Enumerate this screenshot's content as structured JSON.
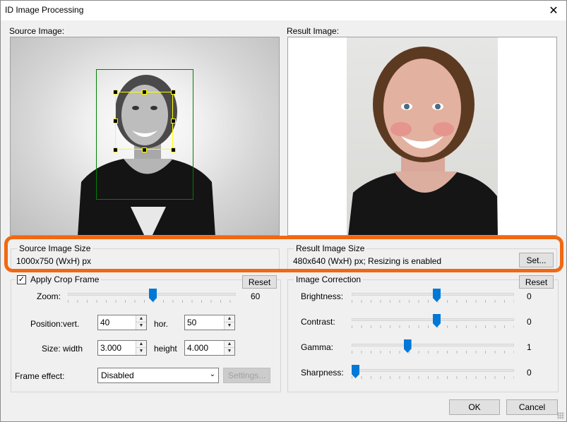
{
  "window": {
    "title": "ID Image Processing"
  },
  "source": {
    "label": "Source Image:"
  },
  "result": {
    "label": "Result Image:"
  },
  "source_size": {
    "title": "Source Image Size",
    "value": "1000x750 (WxH) px"
  },
  "result_size": {
    "title": "Result Image Size",
    "value": "480x640 (WxH) px; Resizing is enabled",
    "set_label": "Set..."
  },
  "crop": {
    "checkbox_label": "Apply Crop Frame",
    "checked": true,
    "reset_label": "Reset",
    "zoom_label": "Zoom:",
    "zoom_value": "60",
    "zoom_level": 0.6,
    "position_label": "Position:",
    "vert_label": "vert.",
    "vert_value": "40",
    "hor_label": "hor.",
    "hor_value": "50",
    "size_label": "Size:",
    "width_label": "width",
    "width_value": "3.000",
    "height_label": "height",
    "height_value": "4.000",
    "frame_effect_label": "Frame effect:",
    "frame_effect_value": "Disabled",
    "settings_label": "Settings..."
  },
  "correction": {
    "title": "Image Correction",
    "reset_label": "Reset",
    "rows": [
      {
        "label": "Brightness:",
        "value": "0",
        "level": 0.5
      },
      {
        "label": "Contrast:",
        "value": "0",
        "level": 0.5
      },
      {
        "label": "Gamma:",
        "value": "1",
        "level": 0.32
      },
      {
        "label": "Sharpness:",
        "value": "0",
        "level": 0.0
      }
    ]
  },
  "footer": {
    "ok_label": "OK",
    "cancel_label": "Cancel"
  },
  "colors": {
    "accent": "#0078d7",
    "highlight": "#f06812",
    "face_frame": "#ffff00",
    "face_outer": "#008000"
  }
}
